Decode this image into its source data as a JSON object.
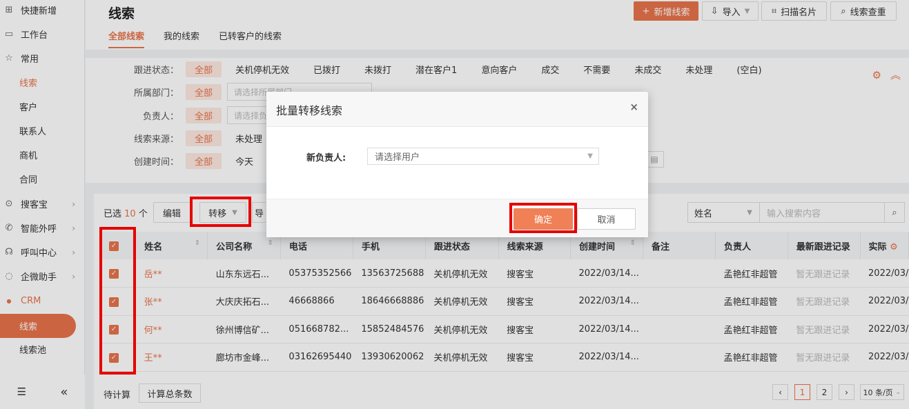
{
  "sidebar": {
    "items": [
      {
        "label": "快捷新增",
        "icon": "add-box-icon"
      },
      {
        "label": "工作台",
        "icon": "monitor-icon"
      },
      {
        "label": "常用",
        "icon": "star-icon"
      },
      {
        "label": "线索"
      },
      {
        "label": "客户"
      },
      {
        "label": "联系人"
      },
      {
        "label": "商机"
      },
      {
        "label": "合同"
      },
      {
        "label": "搜客宝",
        "icon": "search-treasure-icon"
      },
      {
        "label": "智能外呼",
        "icon": "phone-icon"
      },
      {
        "label": "呼叫中心",
        "icon": "headset-icon"
      },
      {
        "label": "企微助手",
        "icon": "chat-icon"
      },
      {
        "label": "CRM",
        "icon": "crm-icon"
      },
      {
        "label": "线索"
      },
      {
        "label": "线索池"
      }
    ]
  },
  "header": {
    "title": "线索",
    "tabs": [
      "全部线索",
      "我的线索",
      "已转客户的线索"
    ],
    "buttons": {
      "new": "新增线索",
      "import": "导入",
      "scan": "扫描名片",
      "dup": "线索查重"
    }
  },
  "filters": {
    "all_label": "全部",
    "follow_status_label": "跟进状态：",
    "follow_status_options": [
      "关机停机无效",
      "已拨打",
      "未拨打",
      "潜在客户1",
      "意向客户",
      "成交",
      "不需要",
      "未成交",
      "未处理",
      "(空白)"
    ],
    "dept_label": "所属部门：",
    "dept_placeholder": "请选择所属部门",
    "owner_label": "负责人：",
    "owner_placeholder": "请选择负",
    "source_label": "线索来源：",
    "source_option": "未处理",
    "created_label": "创建时间：",
    "created_option": "今天"
  },
  "toolbar": {
    "selected_prefix": "已选",
    "selected_count": "10",
    "selected_suffix": "个",
    "edit": "编辑",
    "transfer": "转移",
    "partial": "导",
    "search_field": "姓名",
    "search_placeholder": "输入搜索内容"
  },
  "table": {
    "headers": [
      "姓名",
      "公司名称",
      "电话",
      "手机",
      "跟进状态",
      "线索来源",
      "创建时间",
      "备注",
      "负责人",
      "最新跟进记录",
      "实际"
    ],
    "rows": [
      {
        "name": "岳**",
        "company": "山东东远石...",
        "phone": "05375352566",
        "mobile": "13563725688",
        "status": "关机停机无效",
        "source": "搜客宝",
        "created": "2022/03/14...",
        "note": "",
        "owner": "孟艳红非超管",
        "latest": "暂无跟进记录",
        "actual": "2022/03/"
      },
      {
        "name": "张**",
        "company": "大庆庆拓石...",
        "phone": "46668866",
        "mobile": "18646668886",
        "status": "关机停机无效",
        "source": "搜客宝",
        "created": "2022/03/14...",
        "note": "",
        "owner": "孟艳红非超管",
        "latest": "暂无跟进记录",
        "actual": "2022/03/"
      },
      {
        "name": "何**",
        "company": "徐州博信矿...",
        "phone": "051668782...",
        "mobile": "15852484576",
        "status": "关机停机无效",
        "source": "搜客宝",
        "created": "2022/03/14...",
        "note": "",
        "owner": "孟艳红非超管",
        "latest": "暂无跟进记录",
        "actual": "2022/03/"
      },
      {
        "name": "王**",
        "company": "廊坊市金峰...",
        "phone": "03162695440",
        "mobile": "13930620062",
        "status": "关机停机无效",
        "source": "搜客宝",
        "created": "2022/03/14...",
        "note": "",
        "owner": "孟艳红非超管",
        "latest": "暂无跟进记录",
        "actual": "2022/03/"
      }
    ]
  },
  "footer": {
    "pending": "待计算",
    "calc": "计算总条数",
    "pages": [
      "1",
      "2"
    ],
    "page_size": "10 条/页"
  },
  "modal": {
    "title": "批量转移线索",
    "field_label": "新负责人:",
    "select_placeholder": "请选择用户",
    "ok": "确定",
    "cancel": "取消"
  },
  "colors": {
    "accent": "#e8734a",
    "highlight": "#e60000"
  }
}
